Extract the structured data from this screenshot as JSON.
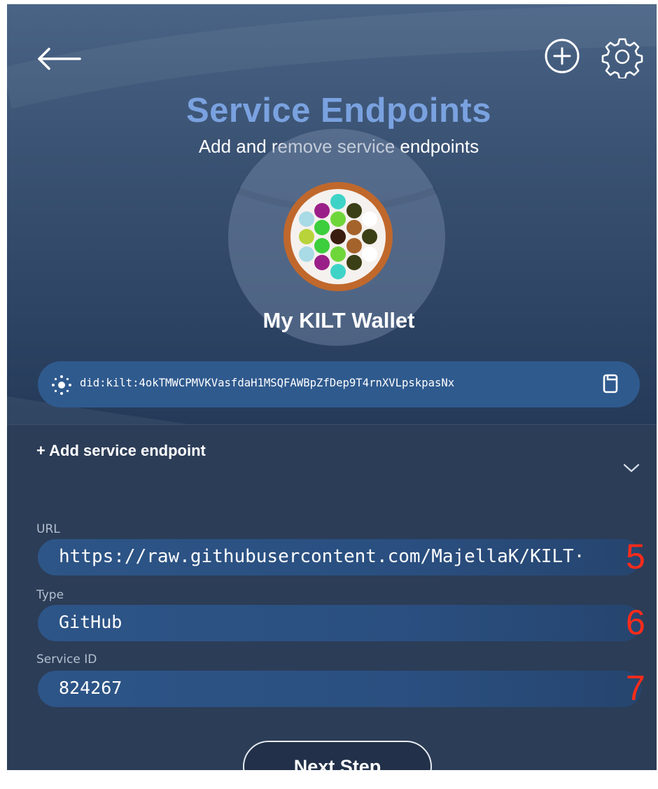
{
  "header": {
    "title": "Service Endpoints",
    "subtitle": "Add and remove service endpoints",
    "back_icon": "arrow-left-icon",
    "add_icon": "plus-circle-icon",
    "settings_icon": "gear-icon"
  },
  "wallet": {
    "name": "My KILT Wallet",
    "did": "did:kilt:4okTMWCPMVKVasfdaH1MSQFAWBpZfDep9T4rnXVLpskpasNx",
    "did_icon": "sparkle-icon",
    "copy_icon": "copy-icon"
  },
  "endpoint_form": {
    "header": "+ Add service endpoint",
    "collapse_icon": "chevron-down-icon",
    "fields": [
      {
        "label": "URL",
        "value": "https://raw.githubusercontent.com/MajellaK/KILT·",
        "marker": "5"
      },
      {
        "label": "Type",
        "value": "GitHub",
        "marker": "6"
      },
      {
        "label": "Service ID",
        "value": "824267",
        "marker": "7"
      }
    ],
    "next_label": "Next Step"
  },
  "colors": {
    "title": "#7aa2e0",
    "pill": "#2f5a8e",
    "marker": "#ff2b1a",
    "panel": "#2c3d57"
  }
}
